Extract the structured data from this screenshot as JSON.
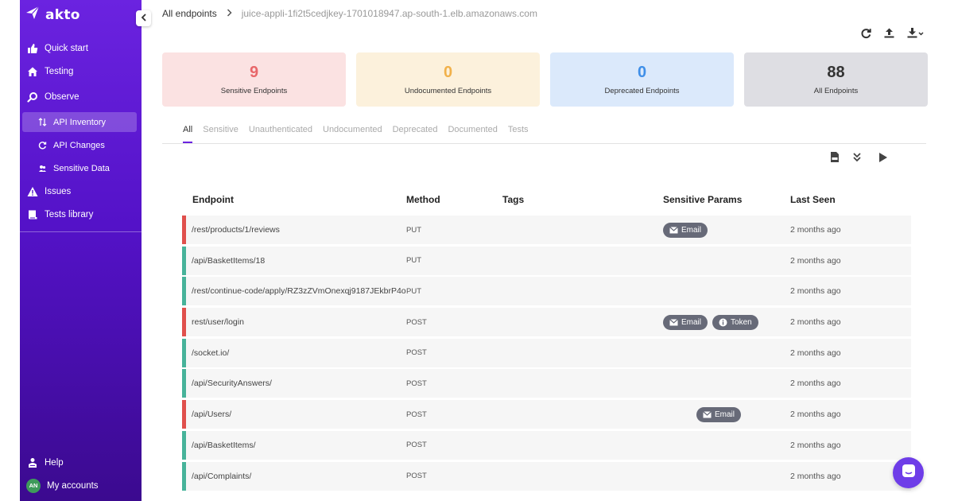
{
  "app": {
    "brand": "akto"
  },
  "sidebar": {
    "items": [
      {
        "label": "Quick start",
        "icon": "thumbs-up-icon"
      },
      {
        "label": "Testing",
        "icon": "home-icon"
      },
      {
        "label": "Observe",
        "icon": "search-icon"
      },
      {
        "label": "API Inventory",
        "icon": "sort-icon"
      },
      {
        "label": "API Changes",
        "icon": "refresh-icon"
      },
      {
        "label": "Sensitive Data",
        "icon": "users-icon"
      },
      {
        "label": "Issues",
        "icon": "warning-icon"
      },
      {
        "label": "Tests library",
        "icon": "book-icon"
      }
    ],
    "bottom": [
      {
        "label": "Help",
        "icon": "help-icon"
      },
      {
        "label": "My accounts",
        "avatar": "AN"
      }
    ]
  },
  "breadcrumb": {
    "root": "All endpoints",
    "current": "juice-appli-1fi2t5cedjkey-1701018947.ap-south-1.elb.amazonaws.com"
  },
  "cards": [
    {
      "value": "9",
      "label": "Sensitive Endpoints",
      "bg": "#fbe2e2",
      "color": "#e8676a"
    },
    {
      "value": "0",
      "label": "Undocumented Endpoints",
      "bg": "#fcf1dc",
      "color": "#f1b14a"
    },
    {
      "value": "0",
      "label": "Deprecated Endpoints",
      "bg": "#dbe9fb",
      "color": "#3f8fe8"
    },
    {
      "value": "88",
      "label": "All Endpoints",
      "bg": "#dedee3",
      "color": "#333333"
    }
  ],
  "tabs": [
    "All",
    "Sensitive",
    "Unauthenticated",
    "Undocumented",
    "Deprecated",
    "Documented",
    "Tests"
  ],
  "table": {
    "headers": {
      "endpoint": "Endpoint",
      "method": "Method",
      "tags": "Tags",
      "sensitive": "Sensitive Params",
      "last_seen": "Last Seen"
    },
    "rows": [
      {
        "endpoint": "/rest/products/1/reviews",
        "method": "PUT",
        "sensitive": [
          {
            "label": "Email",
            "icon": "mail-icon"
          }
        ],
        "last_seen": "2 months ago",
        "status": "#e0504c"
      },
      {
        "endpoint": "/api/BasketItems/18",
        "method": "PUT",
        "sensitive": [],
        "last_seen": "2 months ago",
        "status": "#47b39a"
      },
      {
        "endpoint": "/rest/continue-code/apply/RZ3zZVmOnexqj9187JEkbrP4o",
        "method": "PUT",
        "sensitive": [],
        "last_seen": "2 months ago",
        "status": "#47b39a"
      },
      {
        "endpoint": "rest/user/login",
        "method": "POST",
        "sensitive": [
          {
            "label": "Email",
            "icon": "mail-icon"
          },
          {
            "label": "Token",
            "icon": "info-icon"
          }
        ],
        "last_seen": "2 months ago",
        "status": "#e0504c"
      },
      {
        "endpoint": "/socket.io/",
        "method": "POST",
        "sensitive": [],
        "last_seen": "2 months ago",
        "status": "#47b39a"
      },
      {
        "endpoint": "/api/SecurityAnswers/",
        "method": "POST",
        "sensitive": [],
        "last_seen": "2 months ago",
        "status": "#47b39a"
      },
      {
        "endpoint": "/api/Users/",
        "method": "POST",
        "sensitive": [
          {
            "label": "Email",
            "icon": "mail-icon"
          }
        ],
        "last_seen": "2 months ago",
        "status": "#e0504c",
        "badge_offset": true
      },
      {
        "endpoint": "/api/BasketItems/",
        "method": "POST",
        "sensitive": [],
        "last_seen": "2 months ago",
        "status": "#47b39a"
      },
      {
        "endpoint": "/api/Complaints/",
        "method": "POST",
        "sensitive": [],
        "last_seen": "2 months ago",
        "status": "#47b39a"
      }
    ]
  }
}
